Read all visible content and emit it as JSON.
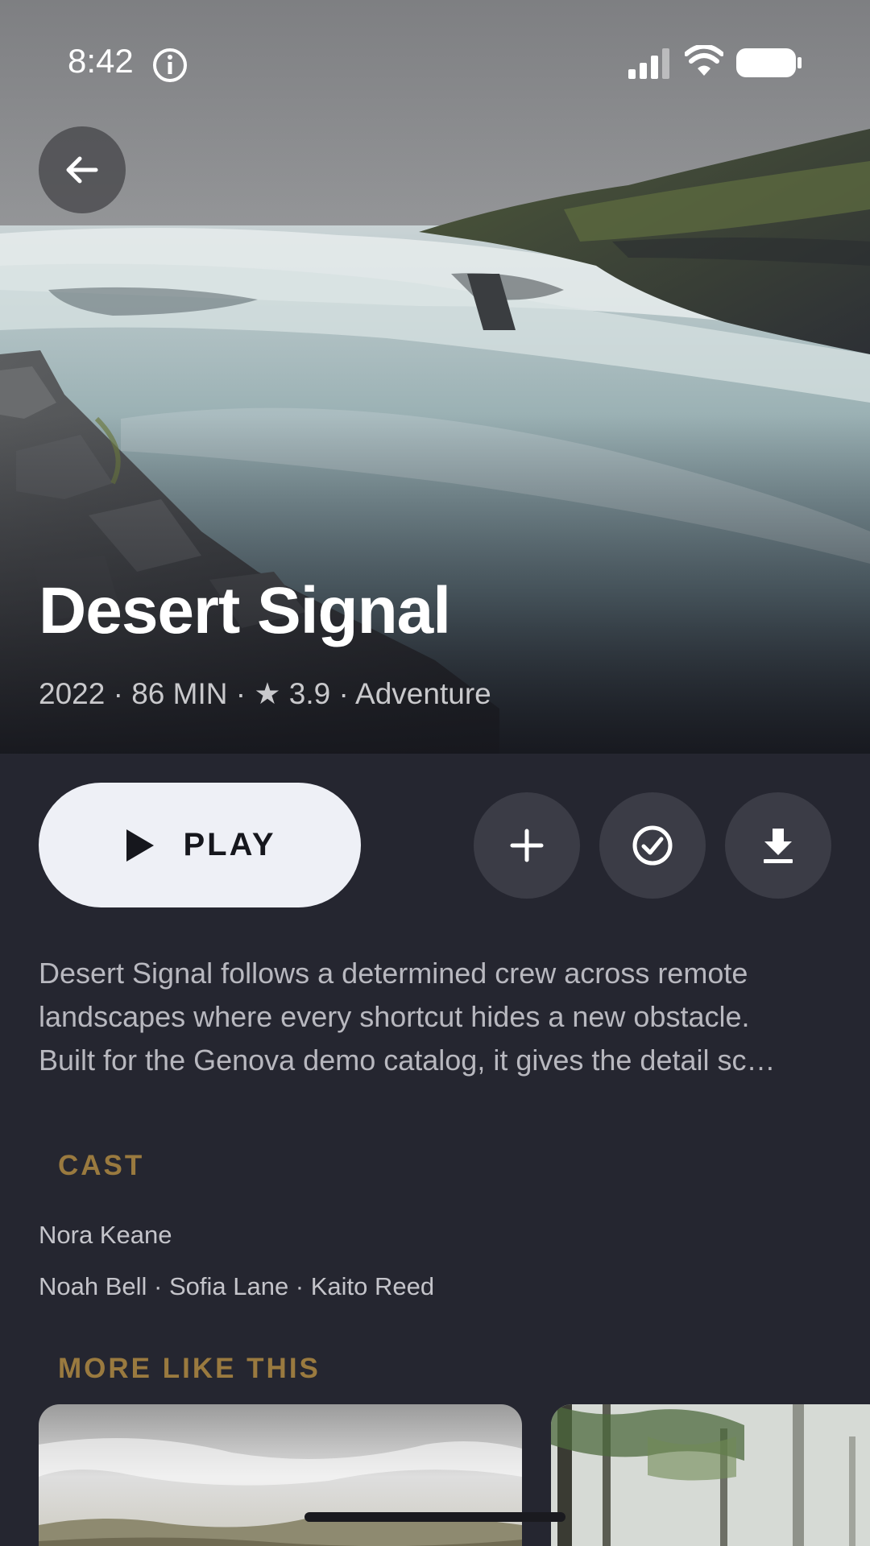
{
  "status_bar": {
    "time": "8:42",
    "icons": [
      "info-icon",
      "signal-icon",
      "wifi-icon",
      "battery-icon"
    ]
  },
  "navigation": {
    "back_icon": "arrow-left-icon"
  },
  "movie": {
    "title": "Desert Signal",
    "meta": "2022 · 86 MIN · ★ 3.9 · Adventure",
    "year": "2022",
    "runtime": "86 MIN",
    "rating": "3.9",
    "genre": "Adventure"
  },
  "actions": {
    "play_label": "PLAY",
    "play_icon": "play-icon",
    "add_icon": "plus-icon",
    "watched_icon": "check-circle-icon",
    "download_icon": "download-icon"
  },
  "synopsis": {
    "line1": "Desert Signal follows a determined crew across remote",
    "line2": "landscapes where every shortcut hides a new obstacle.",
    "line3": "Built for the Genova demo catalog, it gives the detail sc…"
  },
  "cast": {
    "heading": "CAST",
    "lead": "Nora Keane",
    "supporting": "Noah Bell · Sofia Lane · Kaito Reed"
  },
  "more_like_this": {
    "heading": "MORE LIKE THIS"
  },
  "colors": {
    "background": "#252630",
    "accent_gold": "#9a7a3f",
    "play_button": "#eef0f6",
    "round_button": "#3b3c46",
    "body_text": "#b8b8bf"
  }
}
